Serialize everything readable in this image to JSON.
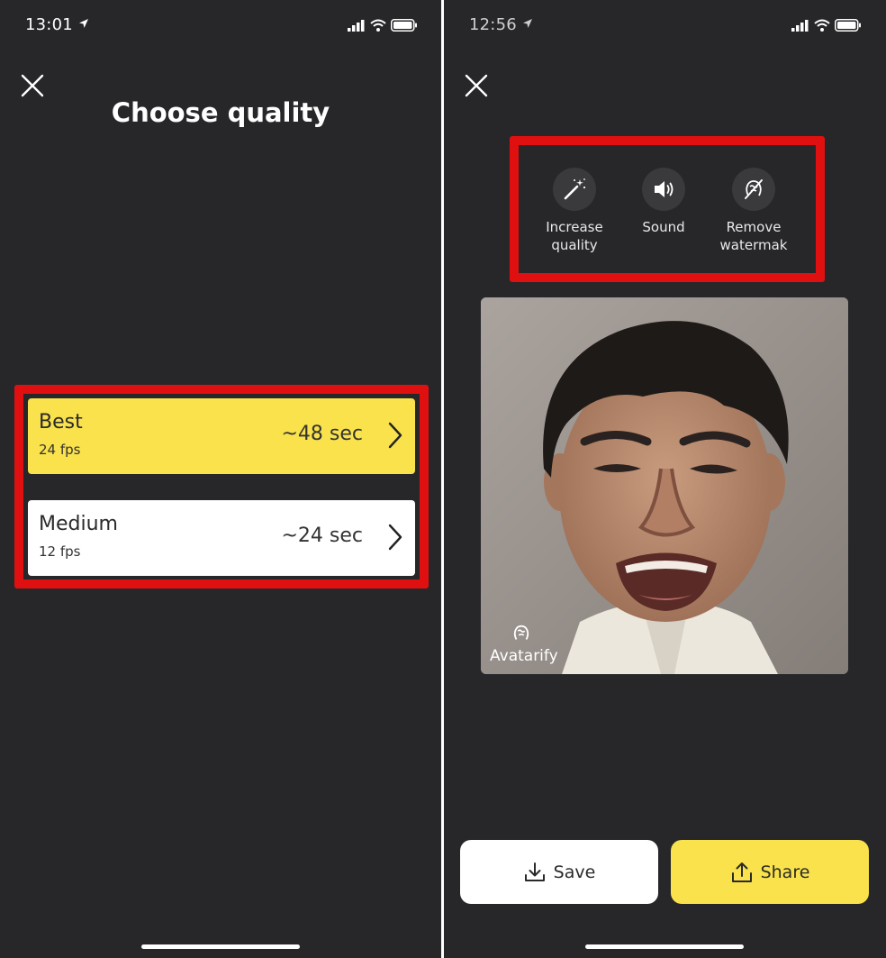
{
  "left": {
    "status": {
      "time": "13:01"
    },
    "title": "Choose quality",
    "options": [
      {
        "name": "Best",
        "fps": "24 fps",
        "time": "~48 sec"
      },
      {
        "name": "Medium",
        "fps": "12 fps",
        "time": "~24 sec"
      }
    ]
  },
  "right": {
    "status": {
      "time": "12:56"
    },
    "tools": [
      {
        "label": "Increase quality",
        "icon": "magic-wand-icon"
      },
      {
        "label": "Sound",
        "icon": "speaker-icon"
      },
      {
        "label": "Remove watermak",
        "icon": "watermark-off-icon"
      }
    ],
    "video": {
      "watermark_text": "Avatarify"
    },
    "actions": {
      "save_label": "Save",
      "share_label": "Share"
    }
  },
  "colors": {
    "background": "#27272a",
    "accent_yellow": "#f9e24b",
    "highlight_red": "#e01010"
  }
}
